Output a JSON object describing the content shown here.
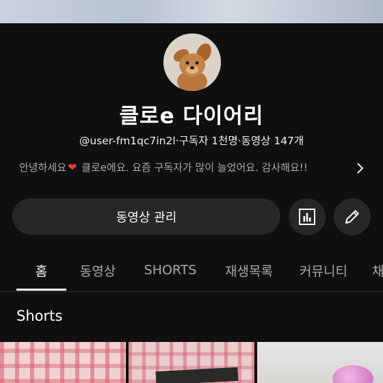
{
  "channel": {
    "name": "클로e 다이어리",
    "meta": "@user-fm1qc7in2l·구독자 1천명·동영상 147개",
    "description_before": "안녕하세요",
    "description_after": "클로e에요. 요즘 구독자가 많이 늘었어요. 감사해요!!",
    "heart_icon": "heart-icon",
    "heart_glyph": "❤"
  },
  "actions": {
    "manage_videos_label": "동영상 관리",
    "analytics_icon": "analytics-icon",
    "edit_icon": "pencil-icon"
  },
  "tabs": [
    {
      "label": "홈",
      "active": true
    },
    {
      "label": "동영상",
      "active": false
    },
    {
      "label": "SHORTS",
      "active": false
    },
    {
      "label": "재생목록",
      "active": false
    },
    {
      "label": "커뮤니티",
      "active": false
    },
    {
      "label": "채",
      "active": false
    }
  ],
  "section": {
    "title": "Shorts"
  },
  "colors": {
    "background": "#0f0f0f",
    "button": "#272727",
    "text_secondary": "#aaaaaa",
    "heart": "#e23b3b"
  }
}
